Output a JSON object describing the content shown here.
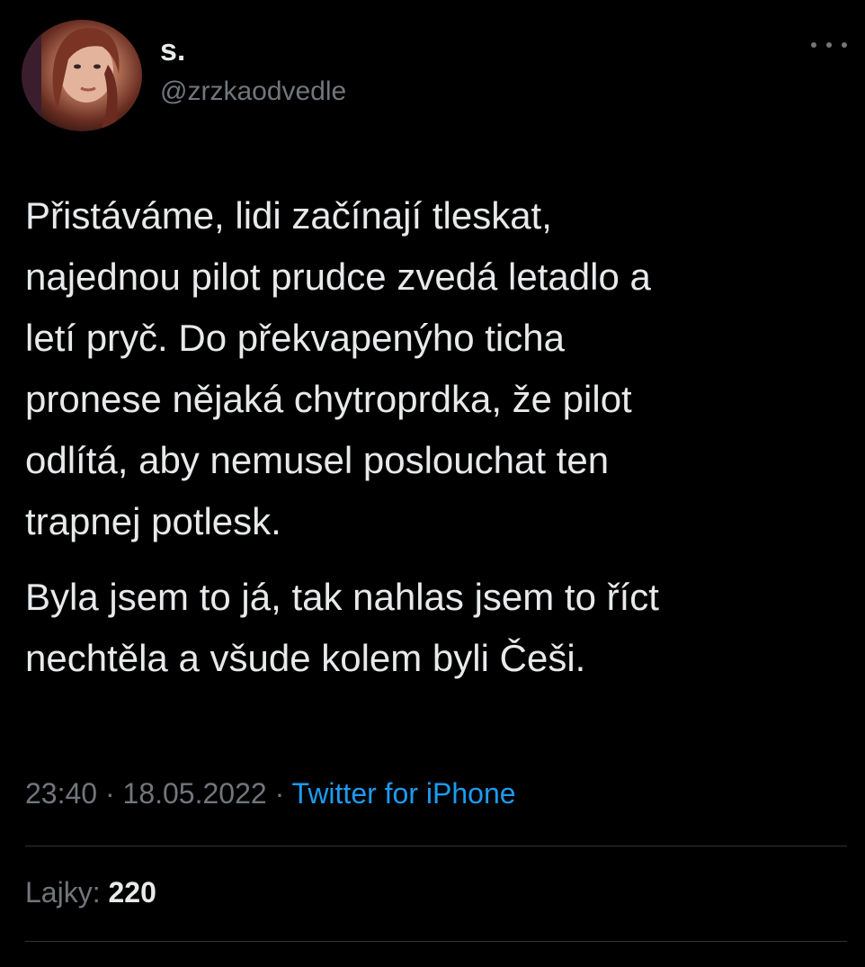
{
  "author": {
    "display_name": "s.",
    "handle": "@zrzkaodvedle"
  },
  "tweet": {
    "paragraphs": [
      "Přistáváme, lidi začínají tleskat,\nnajednou pilot prudce zvedá letadlo a\nletí pryč. Do překvapenýho ticha\npronese nějaká chytroprdka, že pilot\nodlítá, aby nemusel poslouchat ten\ntrapnej potlesk.",
      "Byla jsem to já, tak nahlas jsem to říct\nnechtěla a všude kolem byli Češi."
    ],
    "time": "23:40",
    "separator": "·",
    "date": "18.05.2022",
    "source": "Twitter for iPhone"
  },
  "stats": {
    "likes_label": "Lajky:",
    "likes_count": "220"
  },
  "icons": {
    "more": "more-horizontal-icon",
    "avatar": "avatar"
  },
  "colors": {
    "background": "#000000",
    "text_primary": "#e7e9ea",
    "text_secondary": "#71767b",
    "accent": "#1d9bf0",
    "divider": "#2f3336"
  }
}
